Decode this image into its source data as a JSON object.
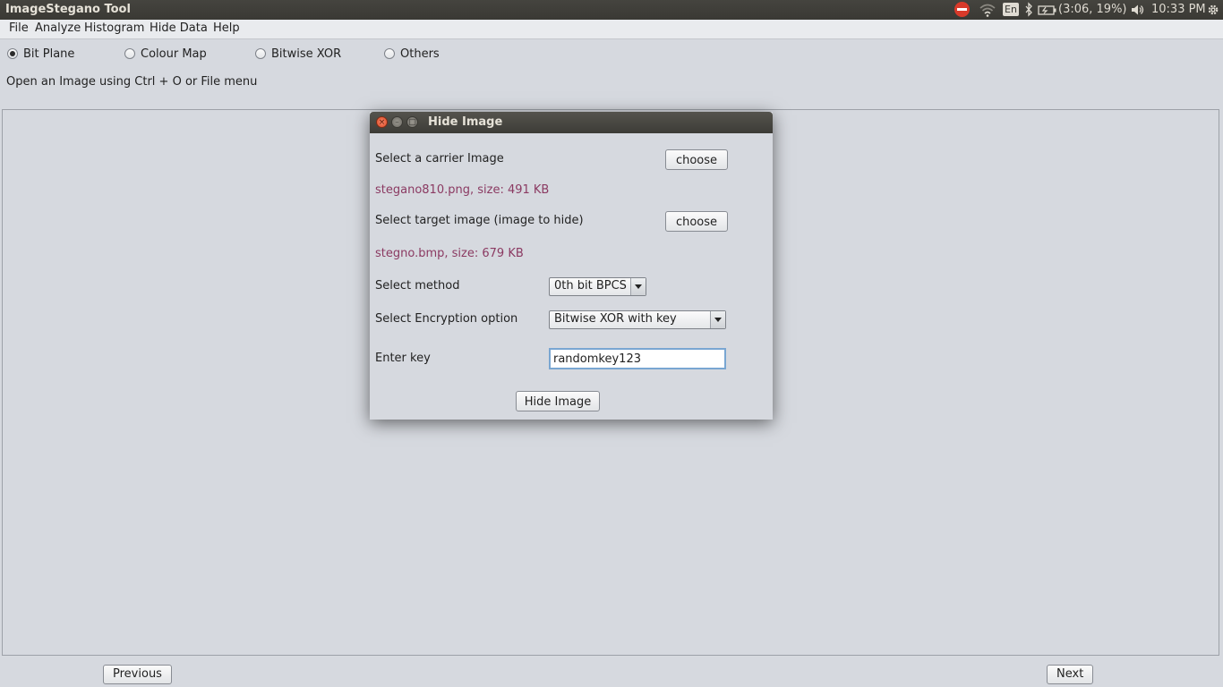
{
  "app": {
    "title": "ImageStegano Tool"
  },
  "tray": {
    "battery": "(3:06, 19%)",
    "clock": "10:33 PM",
    "keyboard": "En",
    "icons": [
      "no-entry-icon",
      "wifi-icon",
      "keyboard-layout-icon",
      "bluetooth-icon",
      "battery-icon",
      "volume-icon",
      "gear-icon"
    ]
  },
  "menu": [
    "File",
    "Analyze",
    "Histogram",
    "Hide Data",
    "Help"
  ],
  "modes": {
    "options": [
      "Bit Plane",
      "Colour Map",
      "Bitwise XOR",
      "Others"
    ],
    "selected": "Bit Plane"
  },
  "hint": "Open an Image using Ctrl + O or File menu",
  "nav": {
    "previous": "Previous",
    "next": "Next"
  },
  "dialog": {
    "title": "Hide Image",
    "carrier_label": "Select a carrier Image",
    "carrier_button": "choose",
    "carrier_info": "stegano810.png, size: 491 KB",
    "target_label": "Select target image (image to hide)",
    "target_button": "choose",
    "target_info": "stegno.bmp, size: 679 KB",
    "method_label": "Select method",
    "method_value": "0th bit BPCS",
    "encryption_label": "Select Encryption option",
    "encryption_value": "Bitwise XOR with key",
    "key_label": "Enter key",
    "key_value": "randomkey123",
    "submit": "Hide Image"
  }
}
